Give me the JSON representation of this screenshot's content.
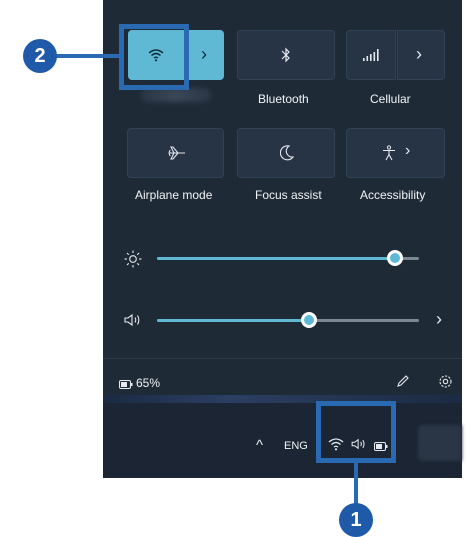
{
  "quick_settings": {
    "tiles": {
      "wifi_chevron": "›",
      "bluetooth_label": "Bluetooth",
      "cellular_label": "Cellular",
      "cellular_chevron": "›",
      "airplane_label": "Airplane mode",
      "focus_label": "Focus assist",
      "accessibility_label": "Accessibility",
      "accessibility_chevron": "›"
    },
    "brightness": {
      "level": 0.91
    },
    "volume": {
      "level": 0.58,
      "chevron": "›"
    },
    "battery_percent": "65%"
  },
  "taskbar": {
    "overflow_chevron": "^",
    "language": "ENG"
  },
  "callouts": {
    "one": "1",
    "two": "2"
  },
  "colors": {
    "accent": "#5fb8d4",
    "panel": "#1f2a37",
    "callout": "#2a6ab2"
  }
}
